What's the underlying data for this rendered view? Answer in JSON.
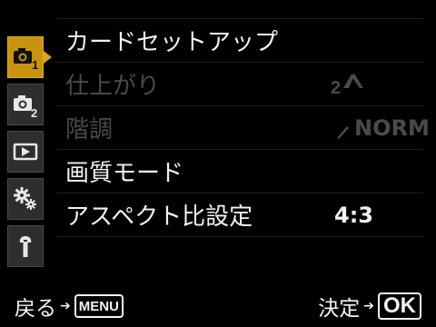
{
  "sidebar": {
    "tabs": [
      {
        "icon": "camera-1-icon",
        "active": true
      },
      {
        "icon": "camera-2-icon",
        "active": false
      },
      {
        "icon": "playback-icon",
        "active": false
      },
      {
        "icon": "custom-settings-icon",
        "active": false
      },
      {
        "icon": "wrench-icon",
        "active": false
      }
    ]
  },
  "menu": {
    "items": [
      {
        "label": "カードセットアップ",
        "value": "",
        "enabled": true
      },
      {
        "label": "仕上がり",
        "value": "",
        "value_icon": "picture-mode-2-icon",
        "enabled": false
      },
      {
        "label": "階調",
        "value": "NORM",
        "value_icon": "gradation-icon",
        "enabled": false
      },
      {
        "label": "画質モード",
        "value": "",
        "enabled": true
      },
      {
        "label": "アスペクト比設定",
        "value": "4:3",
        "enabled": true
      }
    ]
  },
  "footer": {
    "back_label": "戻る",
    "back_button": "MENU",
    "confirm_label": "決定",
    "confirm_button": "OK"
  },
  "colors": {
    "active_tab": "#c8930e",
    "inactive_tab": "#2e2e2e",
    "text": "#f2f2f2",
    "disabled_text": "#4a4a4a",
    "background": "#000000"
  }
}
